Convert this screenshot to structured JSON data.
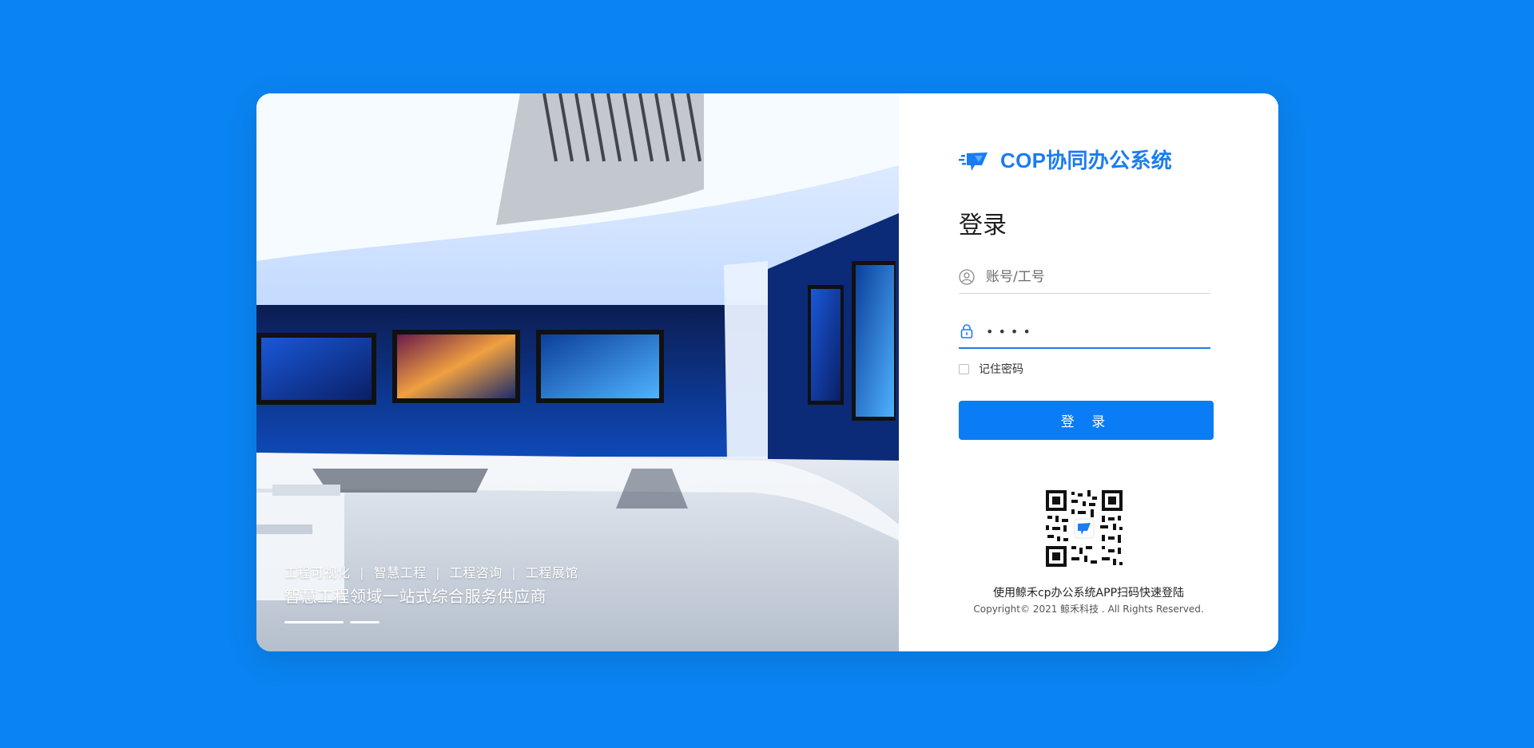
{
  "app": {
    "name": "COP协同办公系统"
  },
  "hero": {
    "tags": [
      "工程可视化",
      "智慧工程",
      "工程咨询",
      "工程展馆"
    ],
    "slogan": "智慧工程领域一站式综合服务供应商",
    "carousel": {
      "slides": 2,
      "active_index": 0
    }
  },
  "login": {
    "title": "登录",
    "username_placeholder": "账号/工号",
    "password_value": "••••",
    "remember_label": "记住密码",
    "remember_checked": false,
    "submit_label": "登 录"
  },
  "qr": {
    "caption": "使用鲸禾cp办公系统APP扫码快速登陆"
  },
  "footer": {
    "copyright": "Copyright© 2021 鲸禾科技 . All Rights Reserved."
  },
  "colors": {
    "page_bg": "#0a84f2",
    "accent": "#1a7cf1",
    "button": "#0a7cf6",
    "panel_bg": "#ffffff"
  }
}
